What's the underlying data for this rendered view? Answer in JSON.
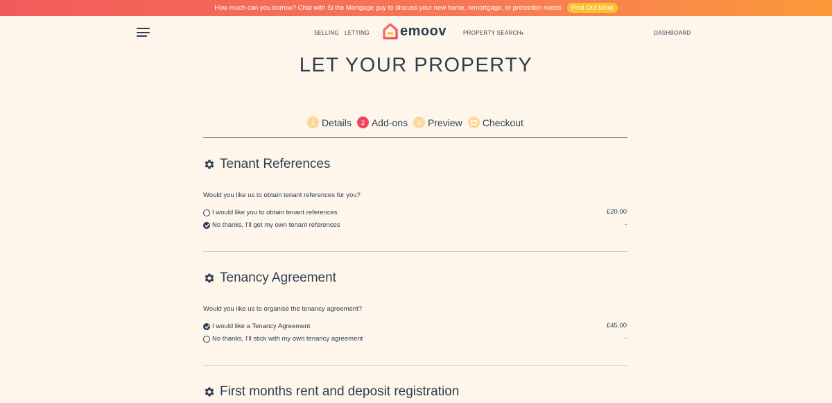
{
  "banner": {
    "text": "How much can you borrow? Chat with Si the Mortgage guy to discuss your new home, remortgage, or protection needs",
    "button": "Find Out More"
  },
  "nav": {
    "selling": "SELLING",
    "letting": "LETTING",
    "logo_text": "emoov",
    "property_search": "PROPERTY SEARCH",
    "dashboard": "DASHBOARD"
  },
  "page": {
    "title": "LET YOUR PROPERTY"
  },
  "steps": [
    {
      "num": "1",
      "label": "Details"
    },
    {
      "num": "2",
      "label": "Add-ons"
    },
    {
      "num": "3",
      "label": "Preview"
    },
    {
      "num": "",
      "label": "Checkout"
    }
  ],
  "sections": [
    {
      "title": "Tenant References",
      "question": "Would you like us to obtain tenant references for you?",
      "options": [
        {
          "label": "I would like you to obtain tenant references",
          "price": "£20.00",
          "checked": false
        },
        {
          "label": "No thanks, I'll get my own tenant references",
          "price": "-",
          "checked": true
        }
      ]
    },
    {
      "title": "Tenancy Agreement",
      "question": "Would you like us to organise the tenancy agreement?",
      "options": [
        {
          "label": "I would like a Tenancy Agreement",
          "price": "£45.00",
          "checked": true
        },
        {
          "label": "No thanks, I'll stick with my own tenancy agreement",
          "price": "-",
          "checked": false
        }
      ]
    },
    {
      "title": "First months rent and deposit registration"
    }
  ],
  "colors": {
    "background": "#fef6ea",
    "text": "#2c3e50",
    "accent": "#ef4561",
    "step_inactive": "#fdd89a",
    "banner_button": "#fbc02d"
  }
}
